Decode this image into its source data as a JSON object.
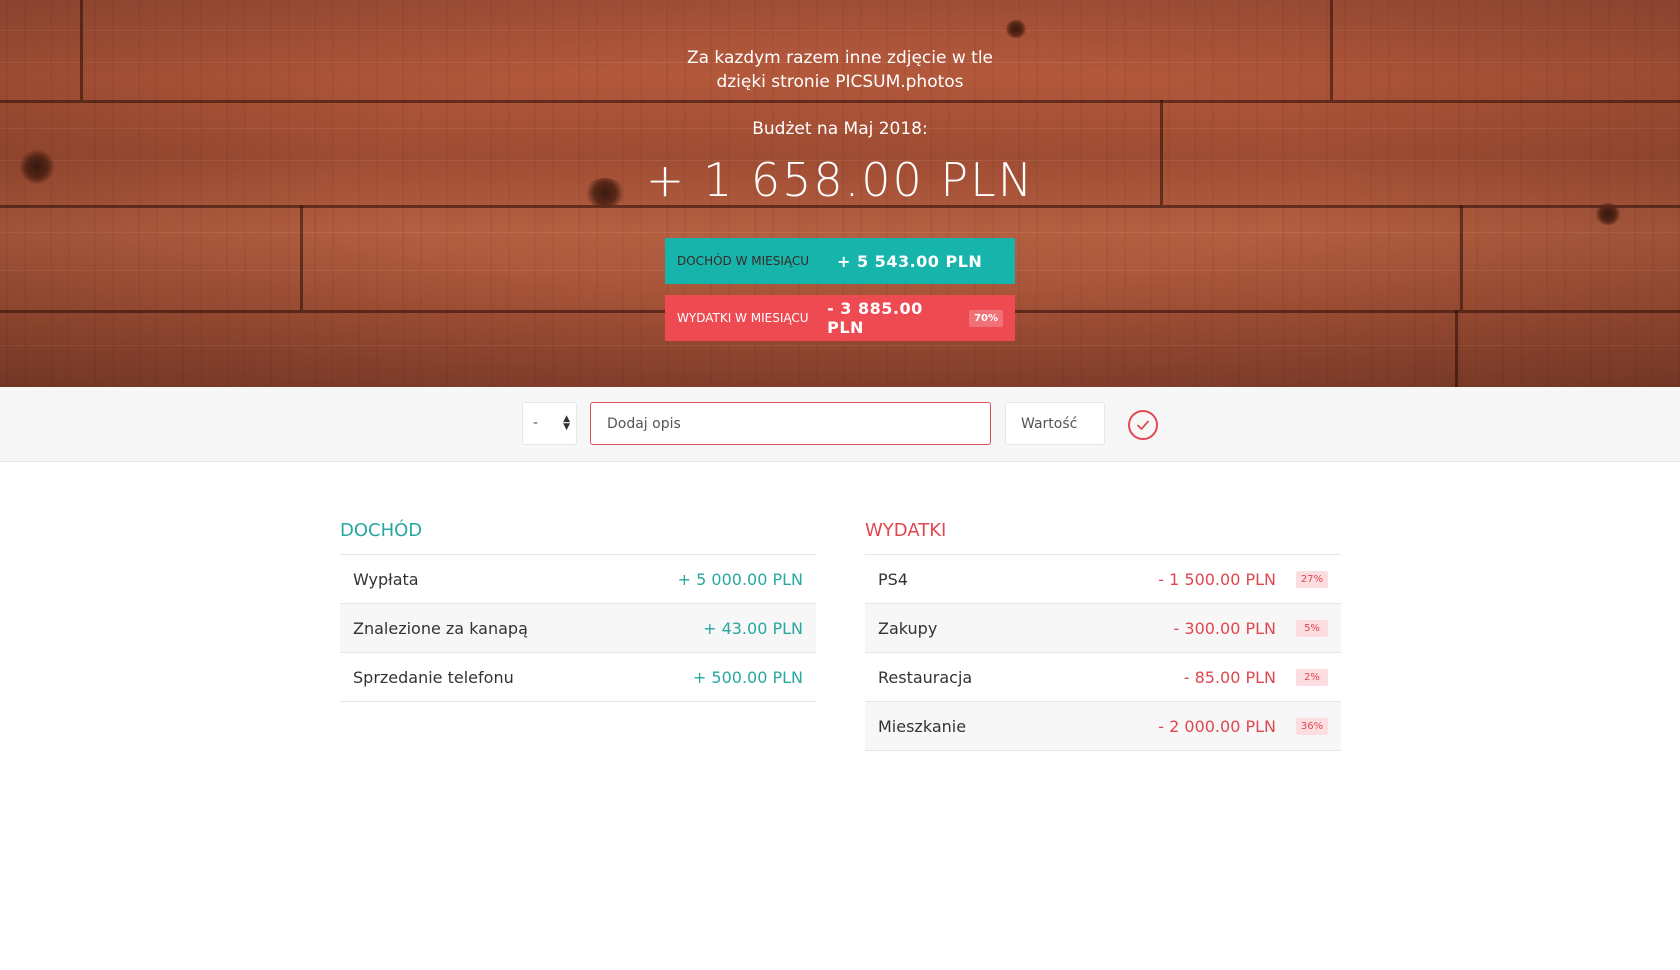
{
  "hero": {
    "tagline": "Za kazdym razem inne zdjęcie w tle dzięki stronie PICSUM.photos",
    "budget_title": "Budżet na Maj 2018:",
    "budget_value": "+ 1 658.00 PLN",
    "income": {
      "label": "Dochód w miesiącu",
      "value": "+ 5 543.00 PLN"
    },
    "expense": {
      "label": "Wydatki w miesiącu",
      "value": "- 3 885.00 PLN",
      "percent": "70%"
    }
  },
  "add_bar": {
    "type_value": "-",
    "description_placeholder": "Dodaj opis",
    "value_placeholder": "Wartość"
  },
  "income_list": {
    "title": "Dochód",
    "items": [
      {
        "description": "Wypłata",
        "value": "+ 5 000.00 PLN"
      },
      {
        "description": "Znalezione za kanapą",
        "value": "+ 43.00 PLN"
      },
      {
        "description": "Sprzedanie telefonu",
        "value": "+ 500.00 PLN"
      }
    ]
  },
  "expense_list": {
    "title": "Wydatki",
    "items": [
      {
        "description": "PS4",
        "value": "- 1 500.00 PLN",
        "percent": "27%"
      },
      {
        "description": "Zakupy",
        "value": "- 300.00 PLN",
        "percent": "5%"
      },
      {
        "description": "Restauracja",
        "value": "- 85.00 PLN",
        "percent": "2%"
      },
      {
        "description": "Mieszkanie",
        "value": "- 2 000.00 PLN",
        "percent": "36%"
      }
    ]
  },
  "colors": {
    "income_accent": "#16b4aa",
    "expense_accent": "#ee4a52"
  },
  "icons": {
    "submit": "checkmark-circle-icon"
  }
}
